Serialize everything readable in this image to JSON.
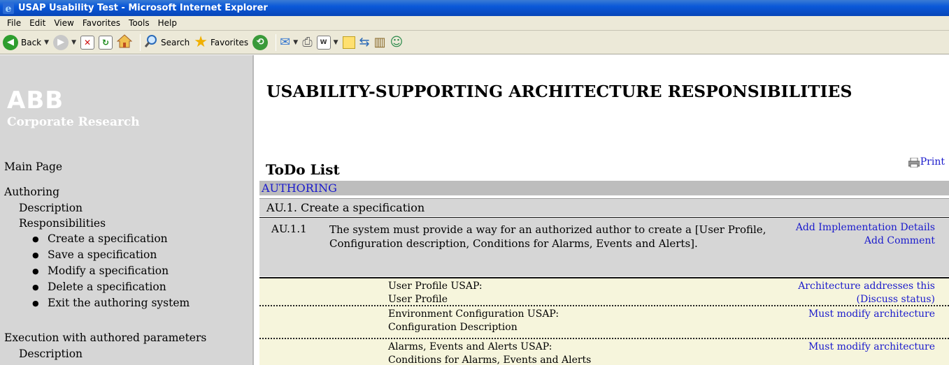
{
  "window": {
    "title": "USAP Usability Test - Microsoft Internet Explorer"
  },
  "menu": [
    "File",
    "Edit",
    "View",
    "Favorites",
    "Tools",
    "Help"
  ],
  "toolbar": {
    "back_label": "Back",
    "search_label": "Search",
    "favorites_label": "Favorites"
  },
  "sidebar": {
    "logo_text": "ABB",
    "logo_subtitle": "Corporate Research",
    "main_page": "Main Page",
    "authoring": {
      "label": "Authoring",
      "description": "Description",
      "responsibilities": "Responsibilities",
      "items": [
        "Create a specification",
        "Save a specification",
        "Modify a specification",
        "Delete a specification",
        "Exit the authoring system"
      ]
    },
    "execution": {
      "label": "Execution with authored parameters",
      "description": "Description"
    }
  },
  "content": {
    "heading": "USABILITY-SUPPORTING ARCHITECTURE RESPONSIBILITIES",
    "todo_title": "ToDo List",
    "print_label": "Print",
    "section": "AUTHORING",
    "subsection": "AU.1. Create a specification",
    "requirement": {
      "id": "AU.1.1",
      "text": "The system must provide a way for an authorized author to create a [User Profile, Configuration description, Conditions for Alarms, Events and Alerts].",
      "add_impl": "Add Implementation Details",
      "add_comment": "Add Comment"
    },
    "usaps": [
      {
        "line1": "User Profile USAP:",
        "line2": "User Profile",
        "status1": "Architecture addresses this",
        "status2": "(Discuss status)"
      },
      {
        "line1": "Environment Configuration USAP:",
        "line2": "Configuration Description",
        "status1": "Must modify architecture",
        "status2": ""
      },
      {
        "line1": "Alarms, Events and Alerts USAP:",
        "line2": "Conditions for Alarms, Events and Alerts",
        "status1": "Must modify architecture",
        "status2": ""
      }
    ]
  },
  "colors": {
    "link": "#1a1acc",
    "panel": "#d6d6d6",
    "usap_bg": "#f6f5dc",
    "titlebar": "#0a58d8"
  }
}
